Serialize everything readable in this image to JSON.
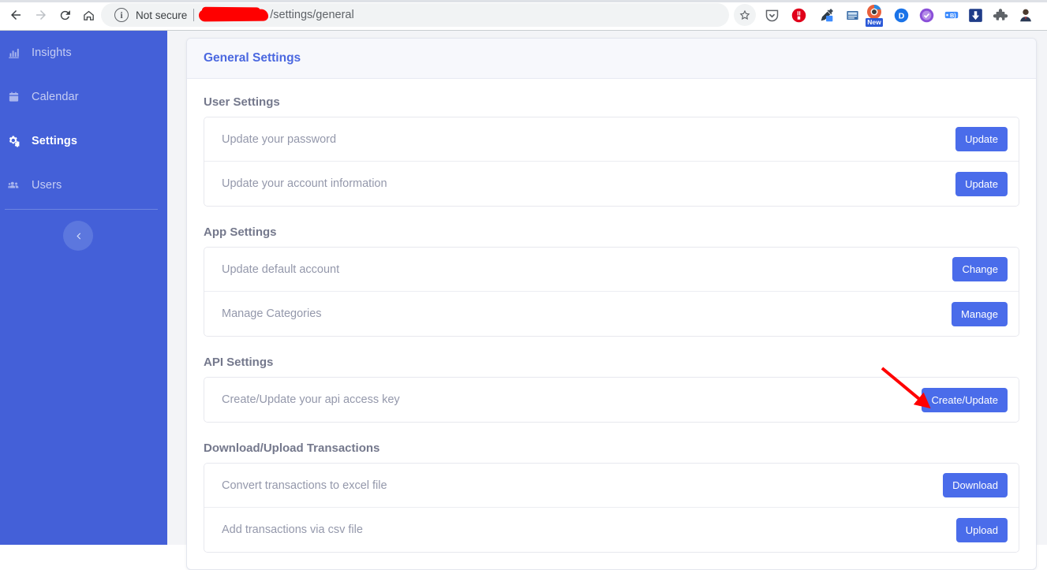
{
  "browser": {
    "back_icon": "back-arrow-icon",
    "forward_icon": "forward-arrow-icon",
    "reload_icon": "reload-icon",
    "home_icon": "home-icon",
    "site_info_icon": "info-circle-icon",
    "security_label": "Not secure",
    "url_redacted": true,
    "url_path": "/settings/general",
    "bookmark_icon": "star-icon",
    "extensions": [
      {
        "name": "pocket-icon",
        "color": "#5f6368"
      },
      {
        "name": "adblock-stop-icon",
        "color": "#e0001a"
      },
      {
        "name": "eyedropper-icon",
        "color": "#4a90e2"
      },
      {
        "name": "reader-icon",
        "color": "#3b6ea8"
      },
      {
        "name": "camera-new-icon",
        "color": "#e8603c",
        "badge": "New"
      },
      {
        "name": "d-circle-icon",
        "color": "#1a73e8"
      },
      {
        "name": "check-badge-icon",
        "color": "#8a4fd8"
      },
      {
        "name": "card-icon",
        "color": "#3d8bfd"
      },
      {
        "name": "download-arrow-icon",
        "color": "#1f3c88"
      },
      {
        "name": "extensions-puzzle-icon",
        "color": "#5f6368"
      },
      {
        "name": "profile-avatar-icon",
        "color": "#3c4043"
      }
    ]
  },
  "sidebar": {
    "items": [
      {
        "label": "Insights",
        "icon": "chart-bar-icon",
        "active": false
      },
      {
        "label": "Calendar",
        "icon": "calendar-icon",
        "active": false
      },
      {
        "label": "Settings",
        "icon": "cogs-icon",
        "active": true
      },
      {
        "label": "Users",
        "icon": "users-icon",
        "active": false
      }
    ],
    "collapse_icon": "chevron-left-icon",
    "background_color": "#4460d8"
  },
  "page": {
    "title": "General Settings",
    "title_color": "#4b68e0",
    "accent_color": "#4a6cea",
    "sections": [
      {
        "title": "User Settings",
        "rows": [
          {
            "label": "Update your password",
            "button": "Update"
          },
          {
            "label": "Update your account information",
            "button": "Update"
          }
        ]
      },
      {
        "title": "App Settings",
        "rows": [
          {
            "label": "Update default account",
            "button": "Change"
          },
          {
            "label": "Manage Categories",
            "button": "Manage"
          }
        ]
      },
      {
        "title": "API Settings",
        "rows": [
          {
            "label": "Create/Update your api access key",
            "button": "Create/Update"
          }
        ]
      },
      {
        "title": "Download/Upload Transactions",
        "rows": [
          {
            "label": "Convert transactions to excel file",
            "button": "Download"
          },
          {
            "label": "Add transactions via csv file",
            "button": "Upload"
          }
        ]
      }
    ]
  },
  "annotation": {
    "type": "arrow",
    "color": "#ff0000",
    "points_to": "Create/Update"
  }
}
